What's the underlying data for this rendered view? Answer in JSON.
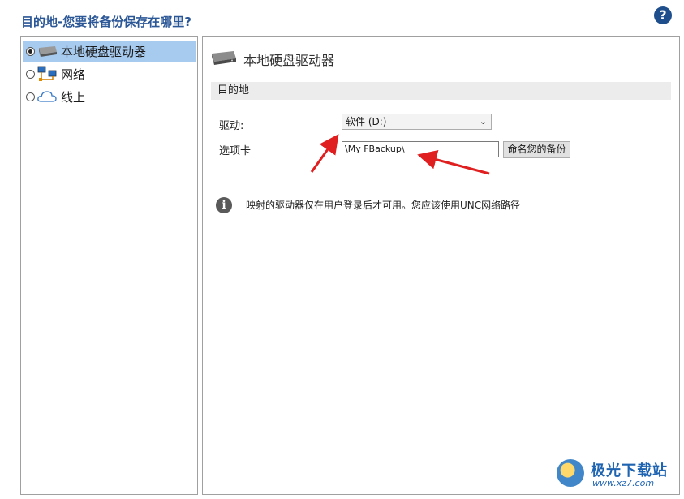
{
  "header": {
    "title": "目的地-您要将备份保存在哪里?",
    "help_icon": "?"
  },
  "left_panel": {
    "options": [
      {
        "label": "本地硬盘驱动器",
        "icon": "hard-drive-icon",
        "selected": true
      },
      {
        "label": "网络",
        "icon": "network-icon",
        "selected": false
      },
      {
        "label": "线上",
        "icon": "cloud-icon",
        "selected": false
      }
    ]
  },
  "right_panel": {
    "title": "本地硬盘驱动器",
    "section_title": "目的地",
    "drive_label": "驱动:",
    "drive_value": "软件 (D:)",
    "folder_label": "选项卡",
    "folder_value": "\\My FBackup\\",
    "name_button": "命名您的备份",
    "info_text": "映射的驱动器仅在用户登录后才可用。您应该使用UNC网络路径"
  },
  "watermark": {
    "name": "极光下载站",
    "url": "www.xz7.com"
  },
  "colors": {
    "selection": "#a7cbef",
    "title": "#2b5797",
    "arrow": "#e02020"
  }
}
